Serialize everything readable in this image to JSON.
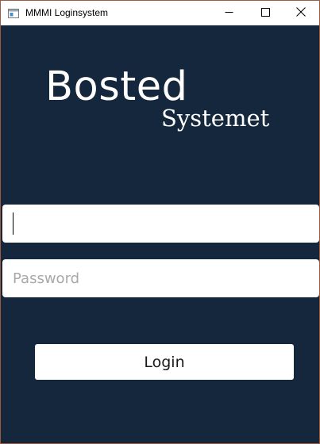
{
  "window": {
    "title": "MMMI Loginsystem",
    "controls": {
      "minimize_icon": "minimize-icon",
      "maximize_icon": "maximize-icon",
      "close_icon": "close-icon"
    }
  },
  "logo": {
    "main_text": "Bosted",
    "sub_text": "Systemet"
  },
  "form": {
    "username": {
      "value": "",
      "placeholder": ""
    },
    "password": {
      "value": "",
      "placeholder": "Password"
    },
    "login_label": "Login"
  },
  "colors": {
    "background": "#14273d",
    "field_background": "#ffffff",
    "placeholder": "#a8a8a8",
    "window_border": "#a05a3a"
  }
}
